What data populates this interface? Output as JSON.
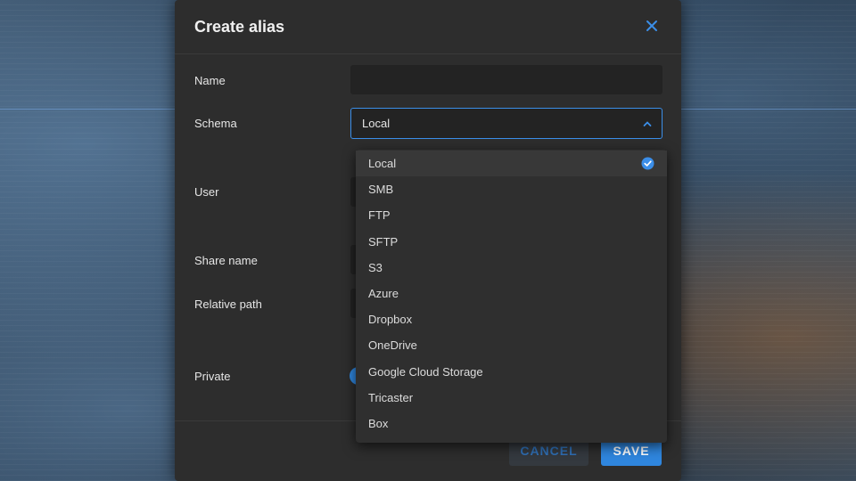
{
  "dialog": {
    "title": "Create alias",
    "close_icon": "close-icon"
  },
  "form": {
    "name_label": "Name",
    "name_value": "",
    "schema_label": "Schema",
    "schema_value": "Local",
    "user_label": "User",
    "share_name_label": "Share name",
    "relative_path_label": "Relative path",
    "private_label": "Private"
  },
  "schema_options": [
    {
      "label": "Local",
      "selected": true
    },
    {
      "label": "SMB"
    },
    {
      "label": "FTP"
    },
    {
      "label": "SFTP"
    },
    {
      "label": "S3"
    },
    {
      "label": "Azure"
    },
    {
      "label": "Dropbox"
    },
    {
      "label": "OneDrive"
    },
    {
      "label": "Google Cloud Storage"
    },
    {
      "label": "Tricaster"
    },
    {
      "label": "Box"
    }
  ],
  "footer": {
    "cancel_label": "CANCEL",
    "save_label": "SAVE"
  },
  "colors": {
    "accent": "#2f86de",
    "dialog_bg": "#2d2d2d",
    "input_bg": "#232323"
  }
}
